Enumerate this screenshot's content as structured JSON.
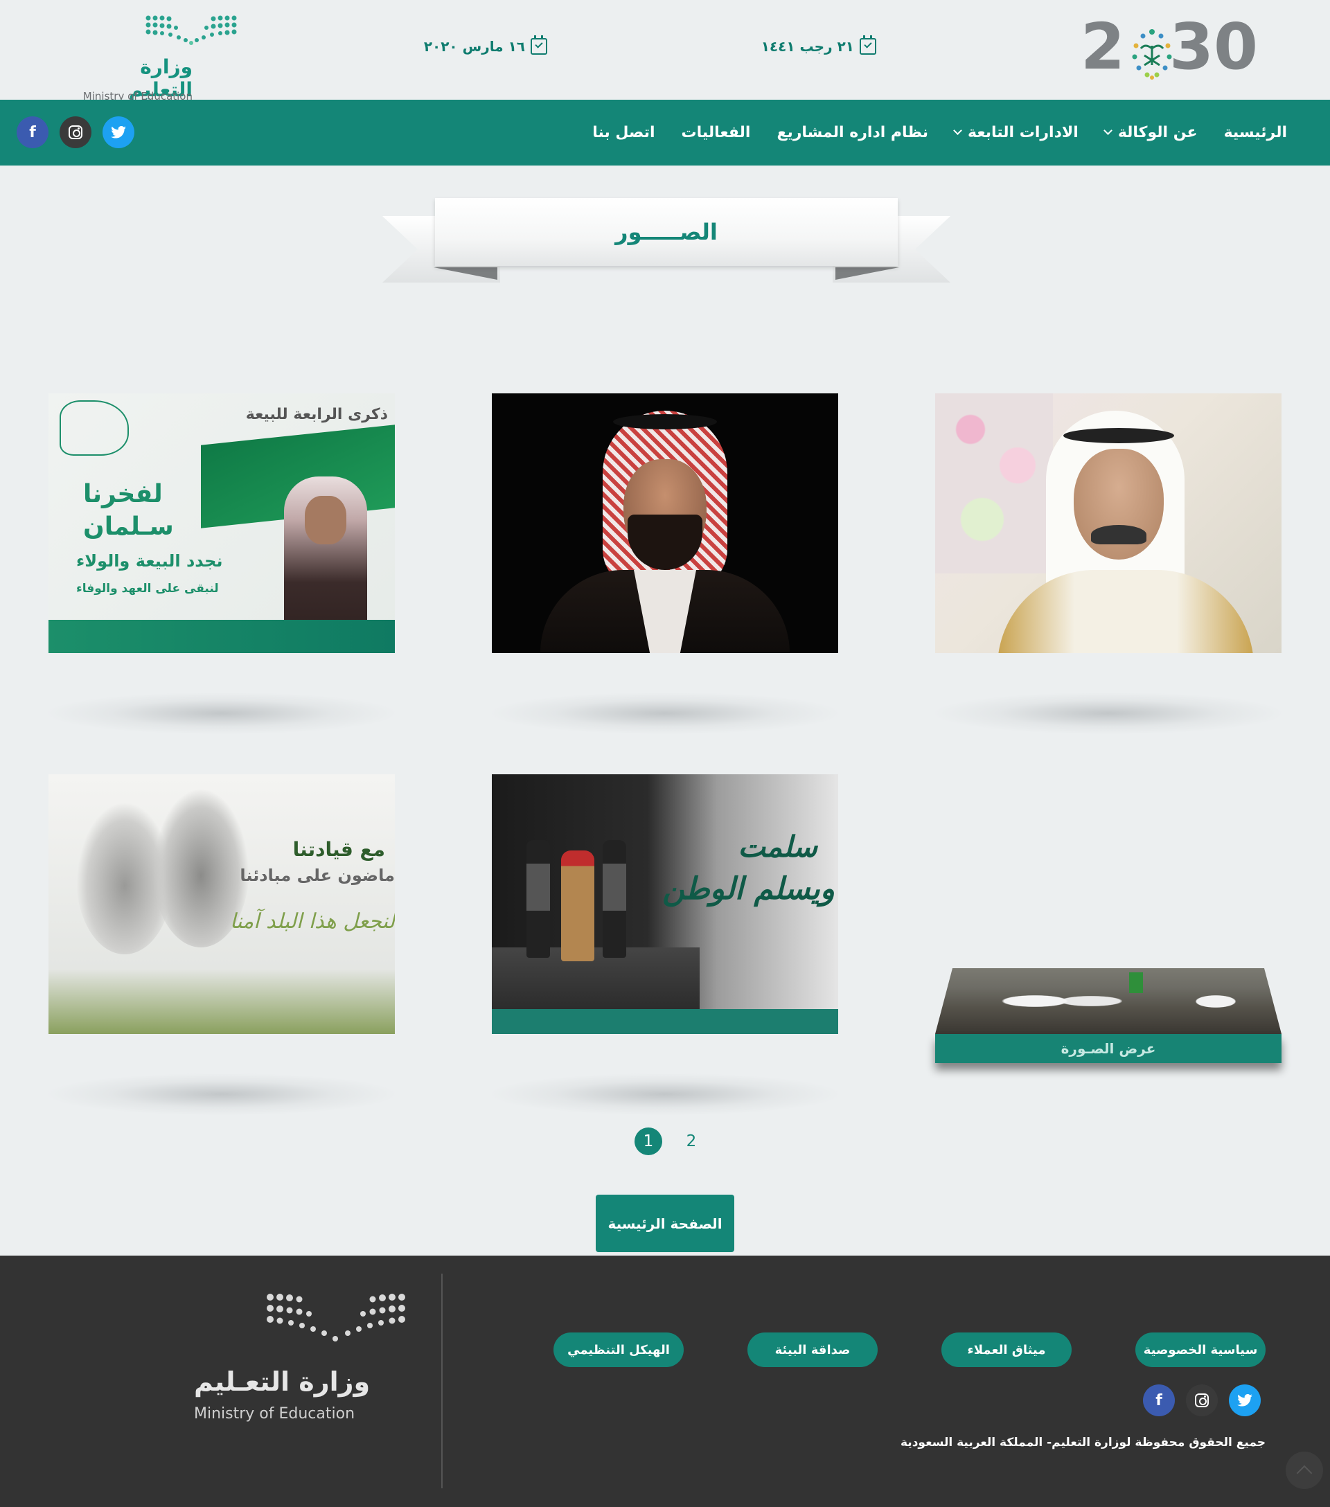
{
  "header": {
    "vision_logo": {
      "left_digit": "2",
      "right_digits": "30"
    },
    "hijri_date": "٢١ رجب ١٤٤١",
    "gregorian_date": "١٦ مارس ٢٠٢٠",
    "ministry_logo": {
      "arabic": "وزارة التعليم",
      "english": "Ministry of Education"
    }
  },
  "nav": {
    "items": [
      {
        "label": "الرئيسية",
        "dropdown": false
      },
      {
        "label": "عن الوكالة",
        "dropdown": true
      },
      {
        "label": "الادارات التابعة",
        "dropdown": true
      },
      {
        "label": "نظام اداره المشاريع",
        "dropdown": false
      },
      {
        "label": "الفعاليات",
        "dropdown": false
      },
      {
        "label": "اتصل بنا",
        "dropdown": false
      }
    ],
    "social": [
      {
        "name": "twitter",
        "glyph": "𝕥",
        "color": "#1da1f2"
      },
      {
        "name": "instagram",
        "color": "#3a3a3a"
      },
      {
        "name": "facebook",
        "glyph": "f",
        "color": "#3b5bb0"
      }
    ]
  },
  "section": {
    "title": "الصـــــور"
  },
  "gallery": {
    "poster": {
      "line1": "ذكرى الرابعة للبيعة",
      "line2": "لفخرنا",
      "line3": "سـلمان",
      "line4": "نجدد البيعة والولاء",
      "line5": "لنبقى على العهد والوفاء"
    },
    "sketch": {
      "line1": "مع قيادتنا",
      "line2": "ماضون على مبادئنا",
      "line3": "لنجعل هذا البلد آمنا"
    },
    "night": {
      "line1": "سلمت",
      "line2": "ويسلم الوطن"
    },
    "hover_caption": "عرض الصـورة"
  },
  "pagination": {
    "pages": [
      "1",
      "2"
    ],
    "current": "1"
  },
  "home_button": "الصفحة الرئيسية",
  "footer": {
    "logo": {
      "arabic": "وزارة التعـليم",
      "english": "Ministry of Education"
    },
    "links": [
      "سياسية الخصوصية",
      "ميثاق العملاء",
      "صداقة البيئة",
      "الهيكل التنظيمي"
    ],
    "copyright": "جميع الحقوق محفوظة لوزارة التعليم- المملكة العربية السعودية"
  },
  "colors": {
    "brand_green": "#148677",
    "footer_bg": "#333333",
    "page_bg": "#eceff0"
  }
}
